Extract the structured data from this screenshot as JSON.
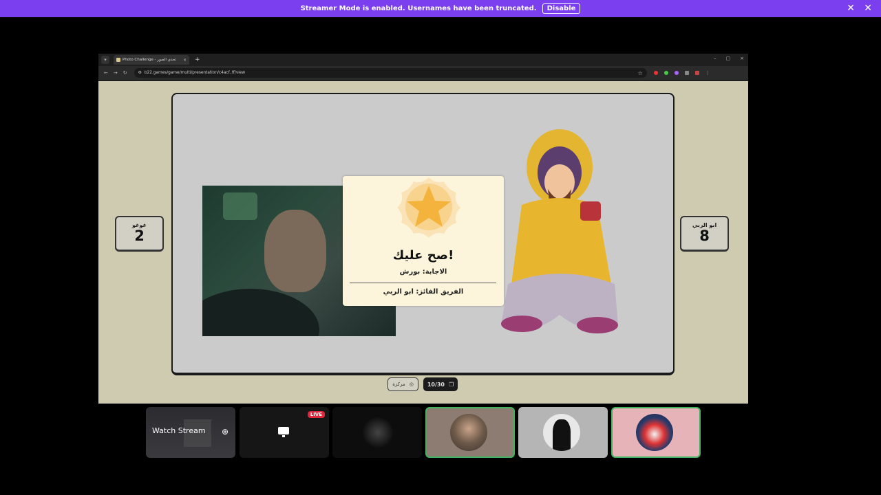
{
  "banner": {
    "message": "Streamer Mode is enabled. Usernames have been truncated.",
    "disable_label": "Disable",
    "close_icon": "close-icon",
    "bg_color": "#7b3ff0"
  },
  "browser": {
    "tab_title": "Photo Challenge - تحدي الصور",
    "tab_close": "×",
    "new_tab": "+",
    "url": "b22.games/game/multi/presentation/c4acf..ff/view",
    "window_controls": [
      "–",
      "▢",
      "×"
    ]
  },
  "game": {
    "team_left": {
      "name": "غوغو",
      "score": "2"
    },
    "team_right": {
      "name": "ابو الربي",
      "score": "8"
    },
    "modal": {
      "title": "صح عليك!",
      "answer": "الاجابة: بورش",
      "winner": "الفريق الفائز: ابو الربي"
    },
    "center_pill": "مركزة",
    "progress": "10/30"
  },
  "tiles": {
    "watch_stream": "Watch Stream",
    "live_badge": "LIVE"
  },
  "colors": {
    "accent_green": "#3fb35e",
    "live_red": "#e0283c",
    "modal_bg": "#fdf5db",
    "page_bg": "#cfcbb0"
  }
}
